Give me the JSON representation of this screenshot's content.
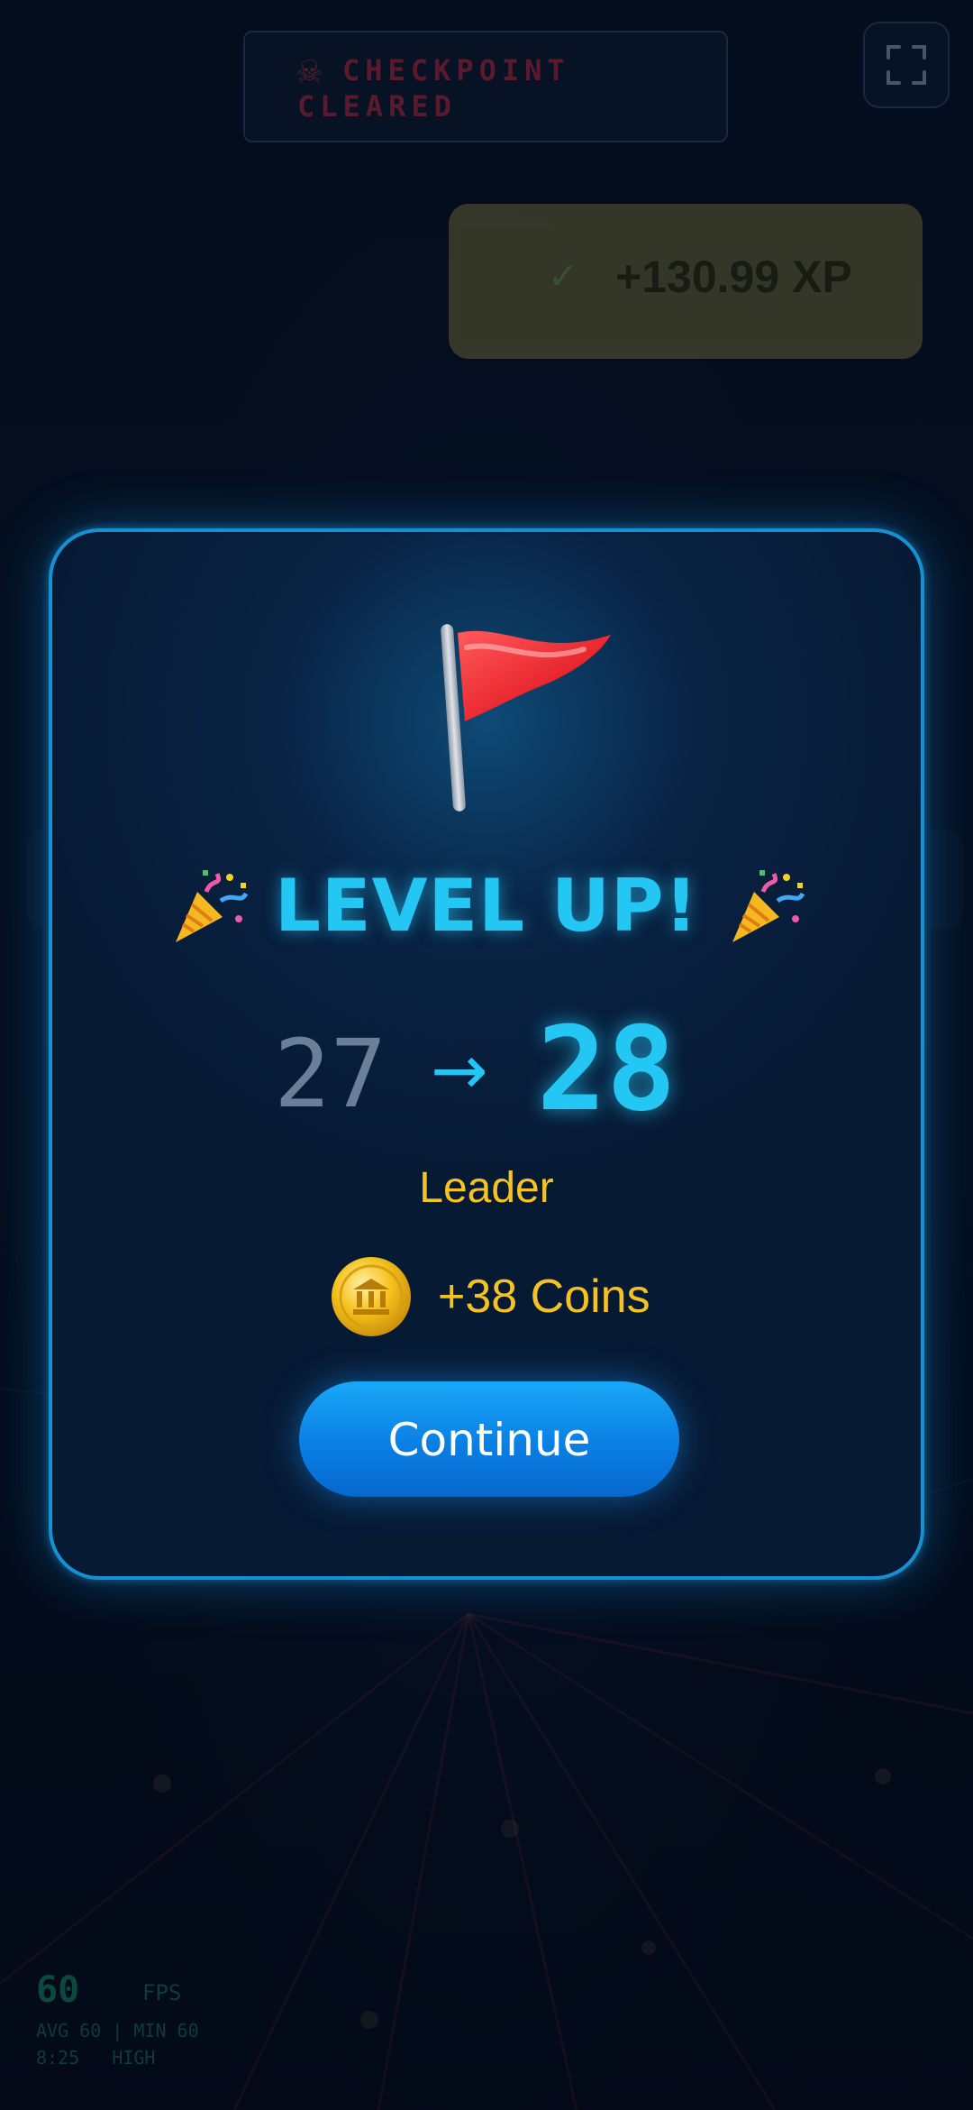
{
  "hud": {
    "banner_text": "CHECKPOINT CLEARED",
    "fullscreen_icon": "fullscreen-icon",
    "xp_toast": "+130.99 XP",
    "fps": {
      "value": "60",
      "unit": "FPS",
      "stats": "AVG 60 | MIN 60",
      "time": "8:25",
      "quality": "HIGH"
    }
  },
  "modal": {
    "title": "LEVEL UP!",
    "old_level": "27",
    "arrow": "→",
    "new_level": "28",
    "rank": "Leader",
    "reward": "+38 Coins",
    "continue_label": "Continue",
    "icons": [
      "flag-icon",
      "party-popper-icon",
      "coin-icon"
    ]
  },
  "colors": {
    "accent": "#24c6f4",
    "gold": "#f4c322",
    "button": "#0a7fe4",
    "border": "#1590d0"
  }
}
